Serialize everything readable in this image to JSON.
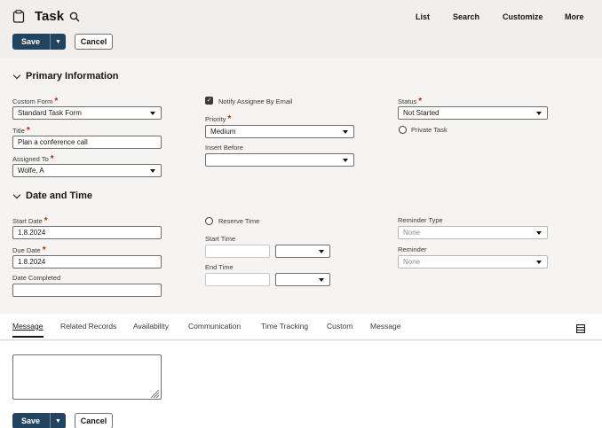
{
  "header": {
    "title": "Task",
    "nav": [
      "List",
      "Search",
      "Customize",
      "More"
    ]
  },
  "actions": {
    "save_label": "Save",
    "cancel_label": "Cancel"
  },
  "primary": {
    "heading": "Primary Information",
    "custom_form_label": "Custom Form",
    "custom_form_value": "Standard Task Form",
    "title_label": "Title",
    "title_value": "Plan a conference call",
    "assigned_to_label": "Assigned To",
    "assigned_to_value": "Wolfe, A",
    "notify_label": "Notify Assignee By Email",
    "notify_checked": true,
    "priority_label": "Priority",
    "priority_value": "Medium",
    "insert_before_label": "Insert Before",
    "insert_before_value": "",
    "status_label": "Status",
    "status_value": "Not Started",
    "private_label": "Private Task",
    "private_checked": false
  },
  "datetime": {
    "heading": "Date and Time",
    "start_date_label": "Start Date",
    "start_date_value": "1.8.2024",
    "due_date_label": "Due Date",
    "due_date_value": "1.8.2024",
    "date_completed_label": "Date Completed",
    "date_completed_value": "",
    "reserve_label": "Reserve Time",
    "reserve_checked": false,
    "start_time_label": "Start Time",
    "end_time_label": "End Time",
    "reminder_type_label": "Reminder Type",
    "reminder_type_value": "None",
    "reminder_label": "Reminder",
    "reminder_value": "None"
  },
  "tabs": [
    "Message",
    "Related Records",
    "Availability",
    "Communication",
    "Time Tracking",
    "Custom",
    "Message"
  ],
  "active_tab": 0,
  "colors": {
    "primary_button": "#23445e",
    "required": "#b3261e"
  }
}
